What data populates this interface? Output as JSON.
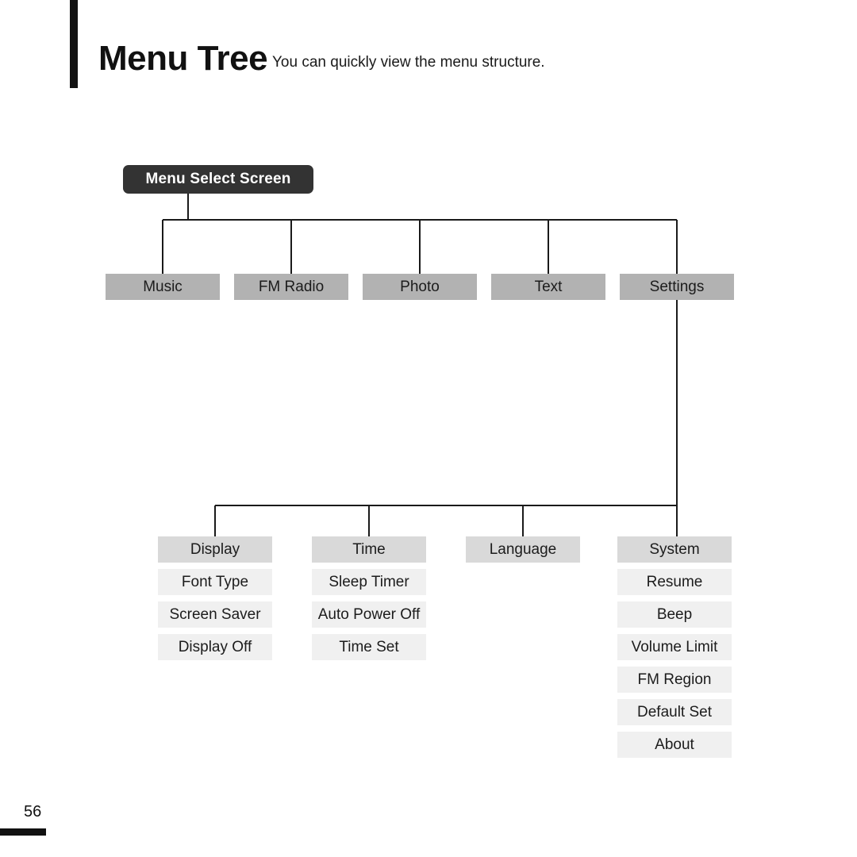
{
  "page": {
    "title": "Menu Tree",
    "subtitle": "You can quickly view the menu structure.",
    "number": "56"
  },
  "colors": {
    "root_fill": "#333333",
    "root_text": "#ffffff",
    "level1_fill": "#b2b2b2",
    "group_head_fill": "#d9d9d9",
    "group_item_fill": "#f0f0f0",
    "rule": "#121212",
    "connector": "#1a1a1a",
    "text": "#1c1c1c"
  },
  "tree": {
    "root": {
      "label": "Menu Select Screen"
    },
    "level1": [
      {
        "label": "Music"
      },
      {
        "label": "FM Radio"
      },
      {
        "label": "Photo"
      },
      {
        "label": "Text"
      },
      {
        "label": "Settings"
      }
    ],
    "settings_groups": [
      {
        "head": "Display",
        "items": [
          "Font Type",
          "Screen Saver",
          "Display Off"
        ]
      },
      {
        "head": "Time",
        "items": [
          "Sleep Timer",
          "Auto Power Off",
          "Time Set"
        ]
      },
      {
        "head": "Language",
        "items": []
      },
      {
        "head": "System",
        "items": [
          "Resume",
          "Beep",
          "Volume Limit",
          "FM Region",
          "Default Set",
          "About"
        ]
      }
    ]
  }
}
